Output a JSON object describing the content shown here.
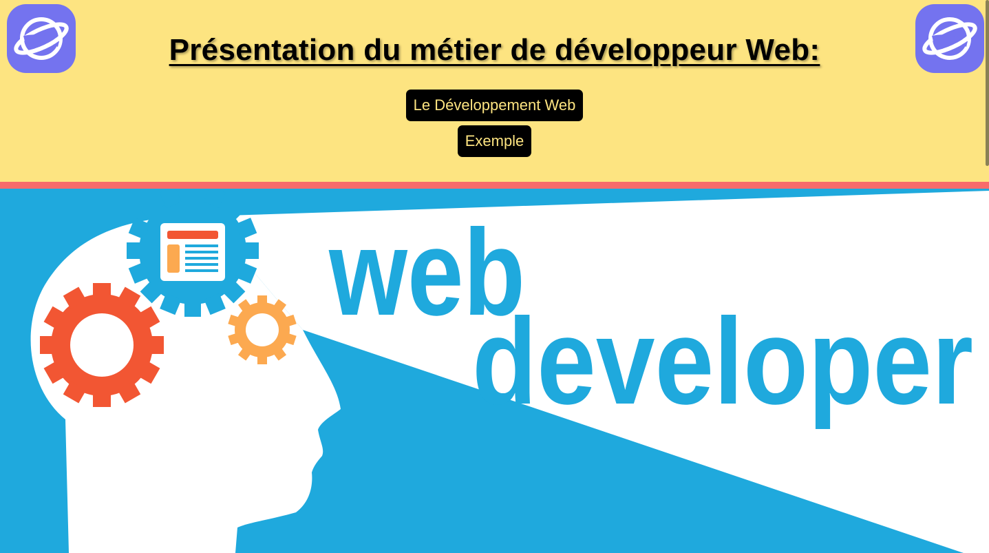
{
  "header": {
    "title": "Présentation du métier de développeur Web:",
    "nav": [
      {
        "label": "Le Développement Web"
      },
      {
        "label": "Exemple"
      }
    ],
    "logo_icon": "planet-ring-icon"
  },
  "hero": {
    "word1": "web",
    "word2": "developer",
    "icons": [
      "head-silhouette-icon",
      "gear-icon",
      "browser-window-icon"
    ]
  },
  "colors": {
    "header_bg": "#fde481",
    "accent_strip": "#f86b6b",
    "button_bg": "#000000",
    "button_text": "#fde481",
    "hero_blue": "#1fa9dd",
    "gear_red": "#f25633",
    "gear_orange": "#fca950",
    "logo_purple": "#7473ef"
  }
}
